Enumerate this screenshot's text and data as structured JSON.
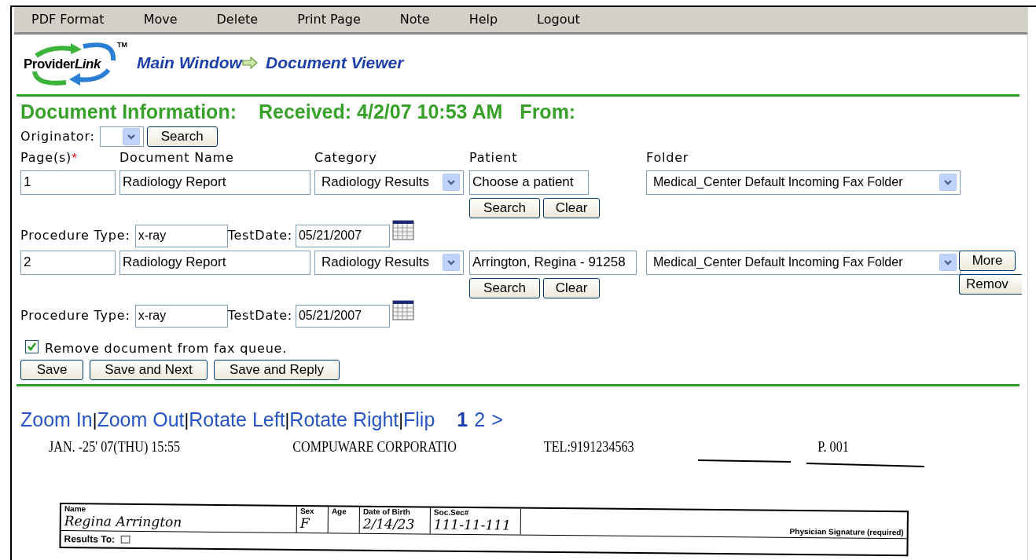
{
  "menu": [
    {
      "label": "PDF Format"
    },
    {
      "label": "Move"
    },
    {
      "label": "Delete"
    },
    {
      "label": "Print Page"
    },
    {
      "label": "Note"
    },
    {
      "label": "Help"
    },
    {
      "label": "Logout"
    }
  ],
  "logo": {
    "text": "Provider",
    "text_italic": "Link",
    "tm": "TM"
  },
  "breadcrumb": [
    {
      "label": "Main Window"
    },
    {
      "label": "Document Viewer"
    }
  ],
  "header": {
    "title": "Document Information:",
    "received": "Received: 4/2/07 10:53 AM",
    "from": "From:"
  },
  "originator": {
    "label": "Originator:",
    "button": "Search"
  },
  "columns": [
    {
      "label": "Page(s)",
      "required_mark": "*"
    },
    {
      "label": "Document Name"
    },
    {
      "label": "Category"
    },
    {
      "label": "Patient"
    },
    {
      "label": "Folder"
    }
  ],
  "documents": [
    {
      "pages": "1",
      "name": "Radiology Report",
      "category": "Radiology Results",
      "patient": "Choose a patient",
      "patient_buttons": [
        "Search",
        "Clear"
      ],
      "folder": "Medical_Center Default Incoming Fax Folder",
      "procedure_label": "Procedure Type:",
      "procedure": "x-ray",
      "testdate_label": "TestDate:",
      "testdate": "05/21/2007"
    },
    {
      "pages": "2",
      "name": "Radiology Report",
      "category": "Radiology Results",
      "patient": "Arrington, Regina - 91258",
      "patient_buttons": [
        "Search",
        "Clear"
      ],
      "folder": "Medical_Center Default Incoming Fax Folder",
      "side_buttons": [
        "More",
        "Remov"
      ],
      "procedure_label": "Procedure Type:",
      "procedure": "x-ray",
      "testdate_label": "TestDate:",
      "testdate": "05/21/2007"
    }
  ],
  "remove_from_queue": {
    "label": "Remove document from fax queue.",
    "checked": true
  },
  "actions": [
    "Save",
    "Save and Next",
    "Save and Reply"
  ],
  "viewer_toolbar": {
    "tools": [
      {
        "label": "Zoom In"
      },
      {
        "label": "Zoom Out"
      },
      {
        "label": "Rotate Left"
      },
      {
        "label": "Rotate Right"
      },
      {
        "label": "Flip"
      }
    ],
    "separator": "|",
    "pages": [
      {
        "label": "1",
        "selected": true
      },
      {
        "label": "2",
        "selected": false
      }
    ],
    "next": ">"
  },
  "fax": {
    "header": [
      "JAN. -25' 07(THU) 15:55",
      "COMPUWARE CORPORATIO",
      "TEL:9191234563",
      "P. 001"
    ],
    "fields": [
      {
        "label": "Name",
        "value": "Regina Arrington"
      },
      {
        "label": "Sex",
        "value": "F"
      },
      {
        "label": "Age"
      },
      {
        "label": "Date of Birth",
        "value": "2/14/23"
      },
      {
        "label": "Soc.Sec#",
        "value": "111-11-111"
      }
    ],
    "signature_label": "Physician Signature (required)",
    "results_to": "Results To:"
  }
}
